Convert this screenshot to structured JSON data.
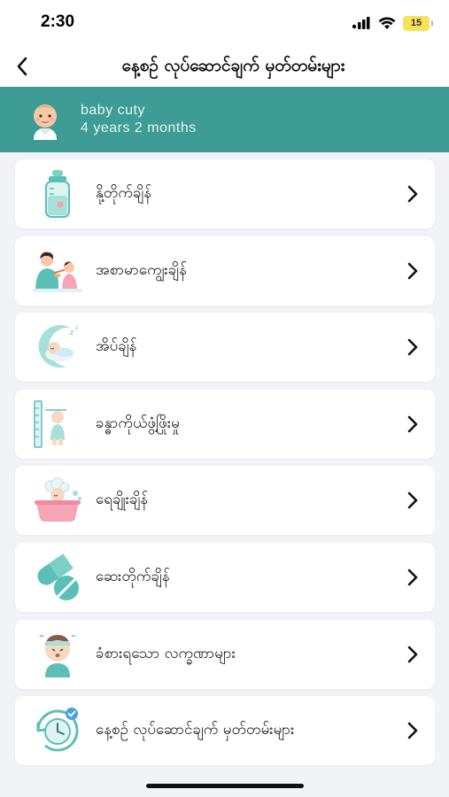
{
  "status_bar": {
    "time": "2:30",
    "battery": "15"
  },
  "header": {
    "title": "နေ့စဉ် လုပ်ဆောင်ချက် မှတ်တမ်းများ"
  },
  "profile": {
    "name": "baby cuty",
    "age": "4 years 2 months"
  },
  "colors": {
    "accent": "#3d9c94",
    "background": "#f2f3f7",
    "card": "#ffffff",
    "icon_teal": "#5bbfb8"
  },
  "menu": [
    {
      "label": "နို့တိုက်ချိန်",
      "icon": "baby-bottle-icon"
    },
    {
      "label": "အစာမာကျွေးချိန်",
      "icon": "feeding-mother-icon"
    },
    {
      "label": "အိပ်ချိန်",
      "icon": "sleeping-moon-icon"
    },
    {
      "label": "ခန္ဓာကိုယ်ဖွံ့ဖြိုးမှု",
      "icon": "height-growth-icon"
    },
    {
      "label": "ရေချိုးချိန်",
      "icon": "bath-icon"
    },
    {
      "label": "ဆေးတိုက်ချိန်",
      "icon": "medicine-pills-icon"
    },
    {
      "label": "ခံစားရသော လက္ခဏာများ",
      "icon": "sick-child-icon"
    },
    {
      "label": "နေ့စဉ် လုပ်ဆောင်ချက် မှတ်တမ်းများ",
      "icon": "clock-history-icon"
    }
  ]
}
